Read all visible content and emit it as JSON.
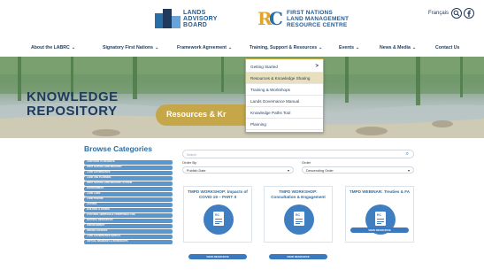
{
  "header": {
    "lab_logo": {
      "line1": "LANDS",
      "line2": "ADVISORY",
      "line3": "BOARD"
    },
    "rc_logo": {
      "line1": "FIRST NATIONS",
      "line2": "LAND MANAGEMENT",
      "line3": "RESOURCE CENTRE"
    },
    "language_link": "Français",
    "icons": [
      "search-icon",
      "facebook-icon"
    ]
  },
  "nav": {
    "items": [
      {
        "label": "About the LABRC"
      },
      {
        "label": "Signatory First Nations"
      },
      {
        "label": "Framework Agreement"
      },
      {
        "label": "Training, Support & Resources"
      },
      {
        "label": "Events"
      },
      {
        "label": "News & Media"
      },
      {
        "label": "Contact Us"
      }
    ]
  },
  "dropdown": {
    "items": [
      {
        "label": "Getting Started",
        "arrow": ">"
      },
      {
        "label": "Resources & Knowledge Sharing",
        "active": true
      },
      {
        "label": "Training & Workshops"
      },
      {
        "label": "Lands Governance Manual"
      },
      {
        "label": "Knowledge Paths Tool"
      },
      {
        "label": "Planning"
      }
    ]
  },
  "hero": {
    "title_line1": "KNOWLEDGE",
    "title_line2": "REPOSITORY",
    "pill_text": "Resources & Kr"
  },
  "browse": {
    "title": "Browse Categories",
    "categories": [
      "ADDITIONS TO RESERVE",
      "FIRST NATION LAND REGISTRY",
      "LAND GOVERNANCE",
      "LAND USE PLANNING",
      "FIRST NATION LAND REGISTRY SYSTEM",
      "ENVIRONMENT",
      "LAND LAWS",
      "LAND TENURE",
      "LEASING",
      "BUILDING & ZONING",
      "CULTURAL HERITAGE & TRADITIONAL USE",
      "NATURAL RESOURCES",
      "ENFORCEMENT",
      "ONLINE COURSES",
      "LAND GOVERNANCE MANUAL",
      "VIRTUAL WEBINARS & WORKSHOPS"
    ]
  },
  "filters": {
    "search_placeholder": "Search",
    "order_by_label": "Order By",
    "order_by_value": "Publish Date",
    "order_label": "Order",
    "order_value": "Descending Order"
  },
  "cards": [
    {
      "title": "TMPD WORKSHOP: Impacts of COVID 19 – PART II",
      "button": "VIEW RESOURCE"
    },
    {
      "title": "TMPD WORKSHOP: Consultation & Engagement",
      "button": "VIEW RESOURCE"
    },
    {
      "title": "TMPD WEBINAR: Treaties & FA",
      "button": "VIEW RESOURCE"
    }
  ],
  "colors": {
    "navy": "#1f3a5c",
    "blue": "#2a6ea8",
    "gold": "#c5a649",
    "category_blue": "#5b97cf"
  }
}
